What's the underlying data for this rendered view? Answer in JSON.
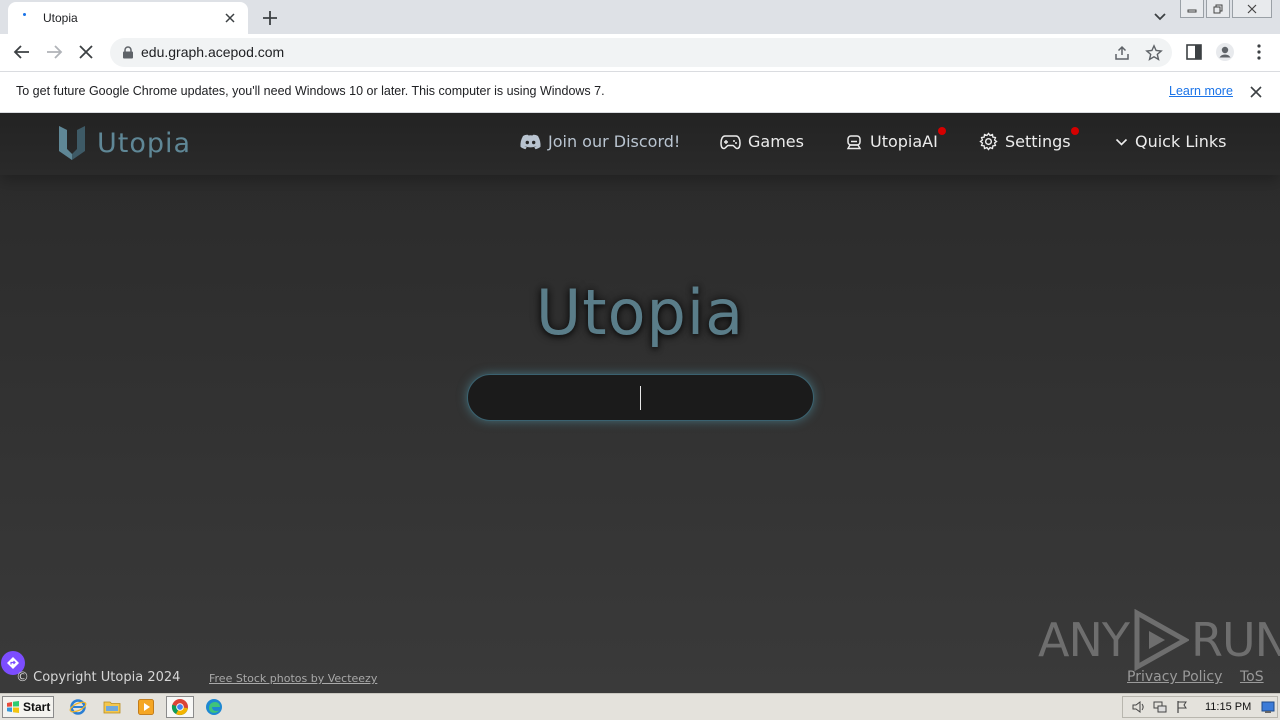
{
  "browser": {
    "tab_title": "Utopia",
    "url": "edu.graph.acepod.com",
    "infobar_message": "To get future Google Chrome updates, you'll need Windows 10 or later. This computer is using Windows 7.",
    "infobar_link": "Learn more"
  },
  "site": {
    "logo_text": "Utopia",
    "nav": {
      "discord": "Join our Discord!",
      "games": "Games",
      "ai": "UtopiaAI",
      "settings": "Settings",
      "quick_links": "Quick Links"
    },
    "hero_title": "Utopia",
    "search_value": "",
    "footer": {
      "copyright": "© Copyright Utopia 2024",
      "stock_link": "Free Stock photos by Vecteezy",
      "privacy": "Privacy Policy",
      "tos": "ToS"
    },
    "watermark_left": "ANY",
    "watermark_right": "RUN"
  },
  "taskbar": {
    "start_label": "Start",
    "clock": "11:15 PM"
  },
  "colors": {
    "accent": "#5a7d89",
    "badge": "#d50000",
    "link": "#1a73e8"
  }
}
